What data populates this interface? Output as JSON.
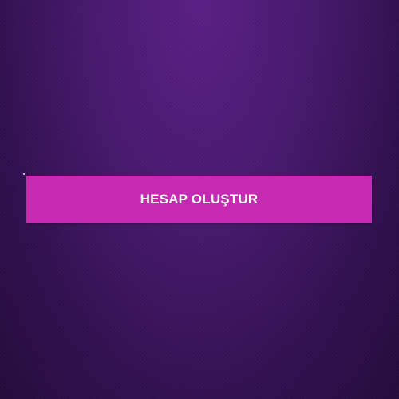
{
  "primary_action": {
    "label": "HESAP OLUŞTUR"
  },
  "colors": {
    "background": "#4a1a72",
    "button": "#c62ab2",
    "button_text": "#ffffff"
  }
}
